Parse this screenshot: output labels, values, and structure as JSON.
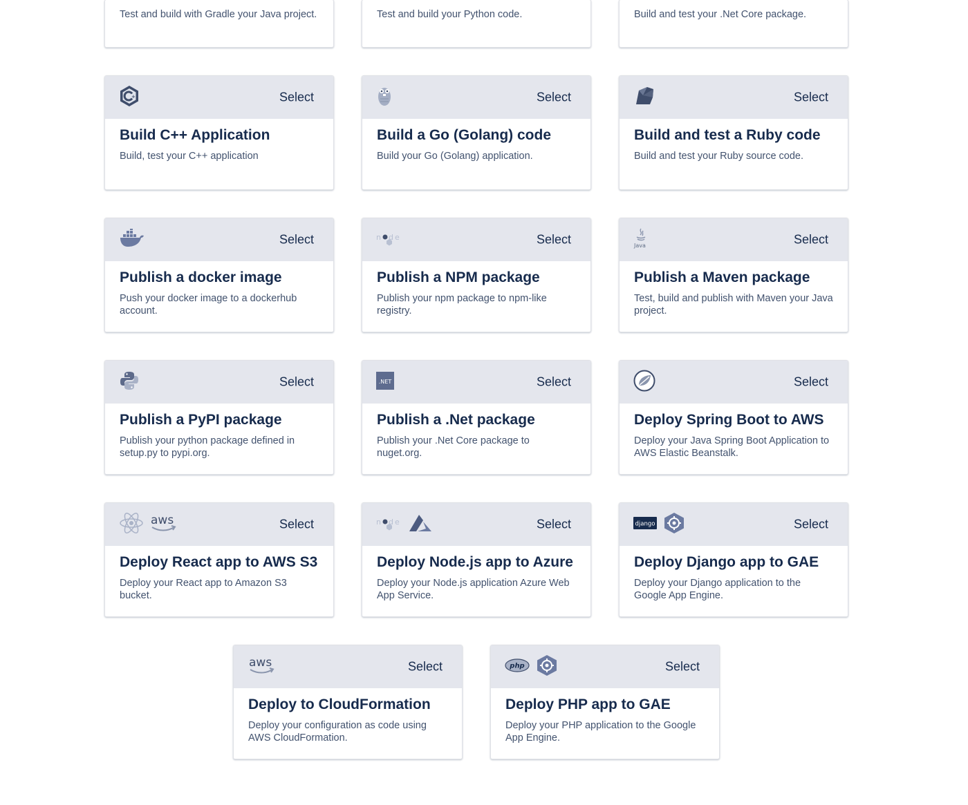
{
  "select_label": "Select",
  "partial_cards": [
    {
      "desc": "Test and build with Gradle your Java project."
    },
    {
      "desc": "Test and build your Python code."
    },
    {
      "desc": "Build and test your .Net Core package."
    }
  ],
  "cards": [
    {
      "title": "Build C++ Application",
      "desc": "Build, test your C++ application",
      "icons": [
        "cpp-icon"
      ]
    },
    {
      "title": "Build a Go (Golang) code",
      "desc": "Build your Go (Golang) application.",
      "icons": [
        "gopher-icon"
      ]
    },
    {
      "title": "Build and test a Ruby code",
      "desc": "Build and test your Ruby source code.",
      "icons": [
        "ruby-icon"
      ]
    },
    {
      "title": "Publish a docker image",
      "desc": "Push your docker image to a dockerhub account.",
      "icons": [
        "docker-icon"
      ]
    },
    {
      "title": "Publish a NPM package",
      "desc": "Publish your npm package to npm-like registry.",
      "icons": [
        "nodejs-icon"
      ]
    },
    {
      "title": "Publish a Maven package",
      "desc": "Test, build and publish with Maven your Java project.",
      "icons": [
        "java-icon"
      ]
    },
    {
      "title": "Publish a PyPI package",
      "desc": "Publish your python package defined in setup.py to pypi.org.",
      "icons": [
        "python-icon"
      ]
    },
    {
      "title": "Publish a .Net package",
      "desc": "Publish your .Net Core package to nuget.org.",
      "icons": [
        "dotnet-icon"
      ]
    },
    {
      "title": "Deploy Spring Boot to AWS",
      "desc": "Deploy your Java Spring Boot Application to AWS Elastic Beanstalk.",
      "icons": [
        "spring-icon"
      ]
    },
    {
      "title": "Deploy React app to AWS S3",
      "desc": "Deploy your React app to Amazon S3 bucket.",
      "icons": [
        "react-icon",
        "aws-icon"
      ]
    },
    {
      "title": "Deploy Node.js app to Azure",
      "desc": "Deploy your Node.js application Azure Web App Service.",
      "icons": [
        "nodejs-icon",
        "azure-icon"
      ]
    },
    {
      "title": "Deploy Django app to GAE",
      "desc": "Deploy your Django application to the Google App Engine.",
      "icons": [
        "django-icon",
        "gae-icon"
      ]
    },
    {
      "title": "Deploy to CloudFormation",
      "desc": "Deploy your configuration as code using AWS CloudFormation.",
      "icons": [
        "aws-icon"
      ]
    },
    {
      "title": "Deploy PHP app to GAE",
      "desc": "Deploy your PHP application to the Google App Engine.",
      "icons": [
        "php-icon",
        "gae-icon"
      ]
    }
  ],
  "icon_text": {
    "aws": "aws",
    "dotnet": ".NET",
    "django": "django",
    "php": "php",
    "java": "Java"
  }
}
